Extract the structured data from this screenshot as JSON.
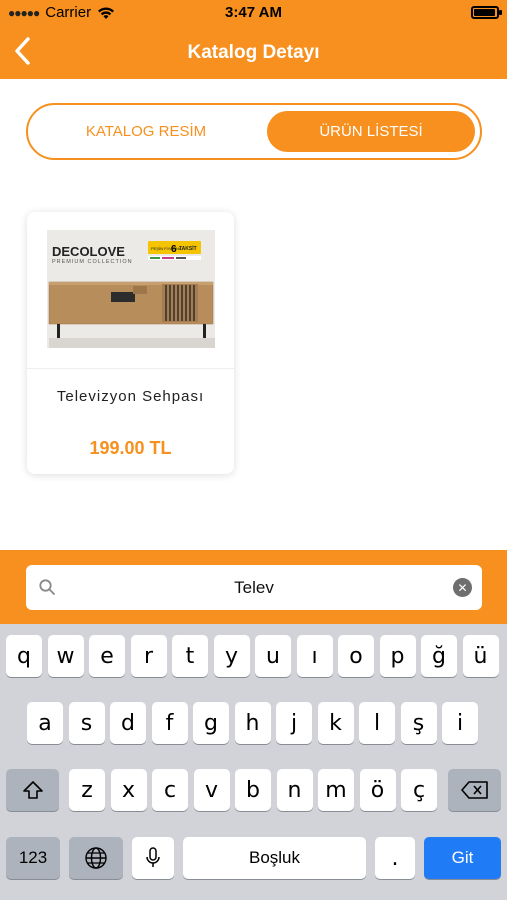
{
  "status_bar": {
    "carrier": "Carrier",
    "time": "3:47 AM"
  },
  "nav": {
    "title": "Katalog Detayı",
    "back_icon": "chevron-left-icon"
  },
  "segmented": {
    "left_label": "KATALOG RESİM",
    "right_label": "ÜRÜN LİSTESİ",
    "active": "right"
  },
  "product": {
    "name": "Televizyon Sehpası",
    "price": "199.00 TL",
    "image": {
      "brand": "DECOLOVE",
      "subtitle": "PREMIUM COLLECTION",
      "badge_left": "PEŞİN FİYATINA",
      "badge_number": "6",
      "badge_right": "TAKSİT"
    }
  },
  "search": {
    "value": "Telev",
    "search_icon": "search-icon",
    "clear_icon": "clear-icon"
  },
  "keyboard": {
    "row1": [
      "q",
      "w",
      "e",
      "r",
      "t",
      "y",
      "u",
      "ı",
      "o",
      "p",
      "ğ",
      "ü"
    ],
    "row2": [
      "a",
      "s",
      "d",
      "f",
      "g",
      "h",
      "j",
      "k",
      "l",
      "ş",
      "i"
    ],
    "row3": [
      "z",
      "x",
      "c",
      "v",
      "b",
      "n",
      "m",
      "ö",
      "ç"
    ],
    "numbers_label": "123",
    "space_label": "Boşluk",
    "period_label": ".",
    "return_label": "Git"
  },
  "colors": {
    "accent": "#F7901E",
    "return_key": "#1F7BF6",
    "keyboard_bg": "#D1D3D9"
  }
}
